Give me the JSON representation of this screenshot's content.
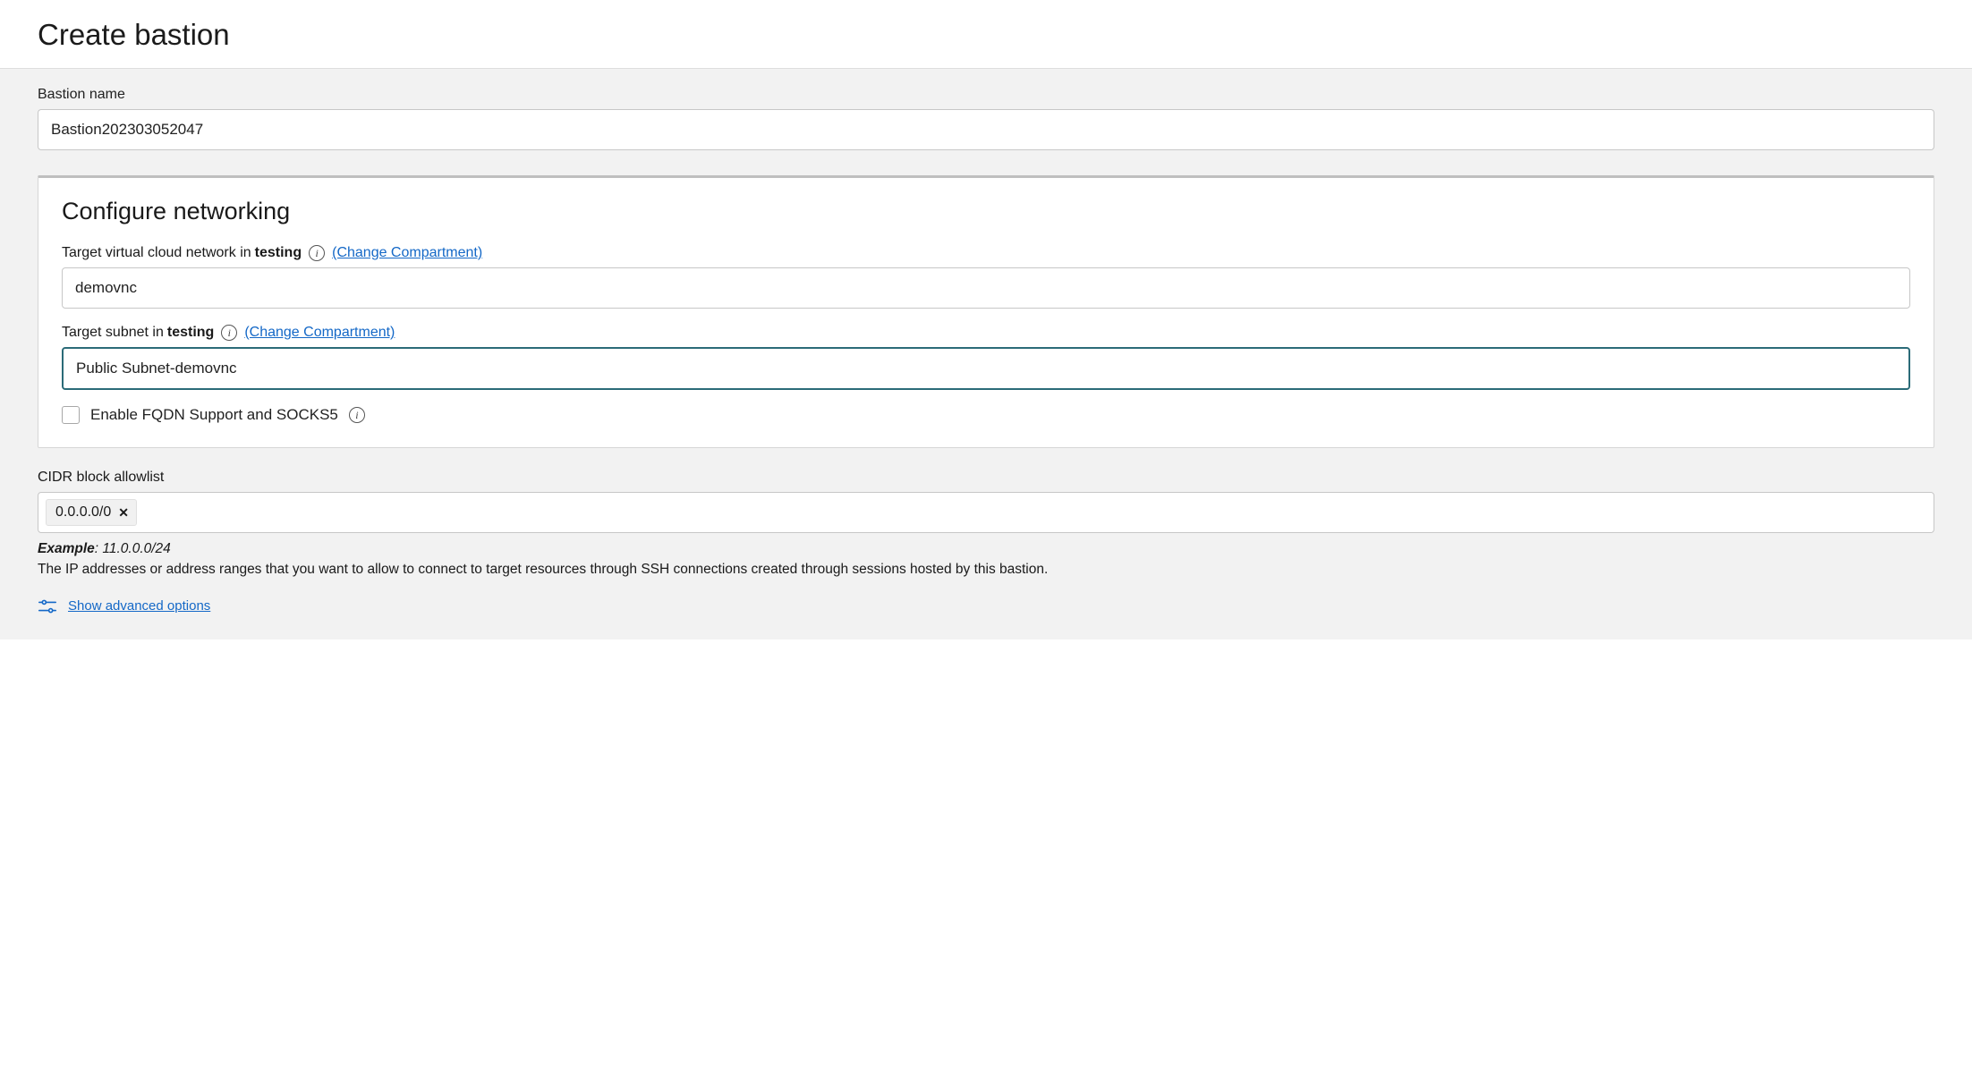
{
  "header": {
    "title": "Create bastion"
  },
  "bastion": {
    "name_label": "Bastion name",
    "name_value": "Bastion202303052047"
  },
  "networking": {
    "section_title": "Configure networking",
    "vcn": {
      "label_prefix": "Target virtual cloud network in",
      "compartment": "testing",
      "change_link": "(Change Compartment)",
      "value": "demovnc"
    },
    "subnet": {
      "label_prefix": "Target subnet in",
      "compartment": "testing",
      "change_link": "(Change Compartment)",
      "value": "Public Subnet-demovnc"
    },
    "fqdn_checkbox_label": "Enable FQDN Support and SOCKS5"
  },
  "cidr": {
    "label": "CIDR block allowlist",
    "chips": [
      "0.0.0.0/0"
    ],
    "example_label": "Example",
    "example_value": ": 11.0.0.0/24",
    "description": "The IP addresses or address ranges that you want to allow to connect to target resources through SSH connections created through sessions hosted by this bastion."
  },
  "advanced": {
    "link": "Show advanced options"
  }
}
